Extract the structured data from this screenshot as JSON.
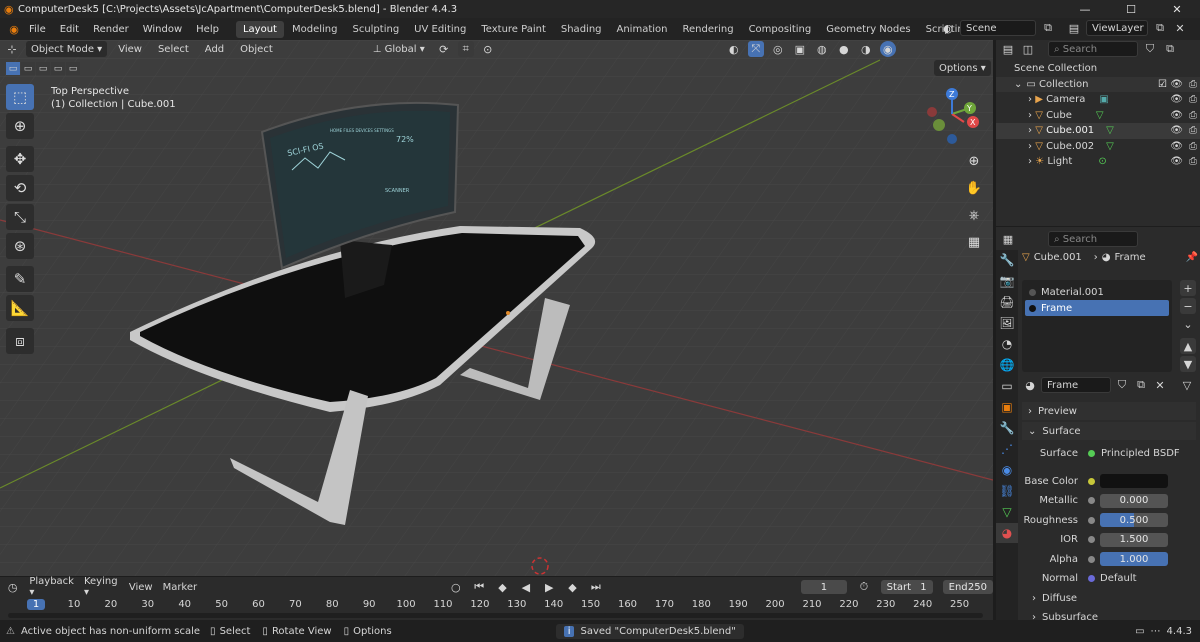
{
  "window": {
    "title": "ComputerDesk5 [C:\\Projects\\Assets\\JcApartment\\ComputerDesk5.blend] - Blender 4.4.3",
    "minimize": "—",
    "maximize": "☐",
    "close": "✕"
  },
  "menu": [
    "File",
    "Edit",
    "Render",
    "Window",
    "Help"
  ],
  "workspaces": [
    "Layout",
    "Modeling",
    "Sculpting",
    "UV Editing",
    "Texture Paint",
    "Shading",
    "Animation",
    "Rendering",
    "Compositing",
    "Geometry Nodes",
    "Scripting",
    "+"
  ],
  "scene": {
    "scene_label": "Scene",
    "viewlayer_label": "ViewLayer"
  },
  "viewport_header": {
    "mode": "Object Mode",
    "view": "View",
    "select": "Select",
    "add": "Add",
    "object": "Object",
    "orientation": "Global",
    "options": "Options"
  },
  "viewport": {
    "perspective": "Top Perspective",
    "collection_info": "(1) Collection | Cube.001",
    "monitor_title": "SCI-FI OS",
    "monitor_pct": "72%",
    "monitor_menu": "HOME  FILES  DEVICES  SETTINGS",
    "monitor_scanner": "SCANNER"
  },
  "gizmo": {
    "x": "X",
    "y": "Y",
    "z": "Z"
  },
  "outliner": {
    "search_placeholder": "Search",
    "root": "Scene Collection",
    "collection": "Collection",
    "items": [
      {
        "name": "Camera"
      },
      {
        "name": "Cube"
      },
      {
        "name": "Cube.001"
      },
      {
        "name": "Cube.002"
      },
      {
        "name": "Light"
      }
    ]
  },
  "properties": {
    "search_placeholder": "Search",
    "breadcrumb_object": "Cube.001",
    "breadcrumb_material": "Frame",
    "slots": [
      "Material.001",
      "Frame"
    ],
    "material_name": "Frame",
    "sections": {
      "preview": "Preview",
      "surface": "Surface",
      "diffuse": "Diffuse",
      "subsurface": "Subsurface"
    },
    "surface_label": "Surface",
    "surface_value": "Principled BSDF",
    "rows": [
      {
        "label": "Base Color",
        "value": ""
      },
      {
        "label": "Metallic",
        "value": "0.000"
      },
      {
        "label": "Roughness",
        "value": "0.500"
      },
      {
        "label": "IOR",
        "value": "1.500"
      },
      {
        "label": "Alpha",
        "value": "1.000"
      },
      {
        "label": "Normal",
        "value": "Default"
      }
    ],
    "roughness_fill": 0.5,
    "alpha_fill": 1.0,
    "base_color": "#111111"
  },
  "timeline": {
    "playback": "Playback",
    "keying": "Keying",
    "view": "View",
    "marker": "Marker",
    "current_frame": "1",
    "start_label": "Start",
    "start": "1",
    "end_label": "End",
    "end": "250",
    "ticks": [
      "1",
      "10",
      "20",
      "30",
      "40",
      "50",
      "60",
      "70",
      "80",
      "90",
      "100",
      "110",
      "120",
      "130",
      "140",
      "150",
      "160",
      "170",
      "180",
      "190",
      "200",
      "210",
      "220",
      "230",
      "240",
      "250"
    ]
  },
  "status": {
    "warning": "Active object has non-uniform scale",
    "select": "Select",
    "rotate": "Rotate View",
    "options": "Options",
    "saved": "Saved \"ComputerDesk5.blend\"",
    "version": "4.4.3"
  },
  "colors": {
    "accent": "#4772b3",
    "header": "#303030",
    "panel": "#2b2b2b",
    "viewport": "#3d3d3d"
  }
}
